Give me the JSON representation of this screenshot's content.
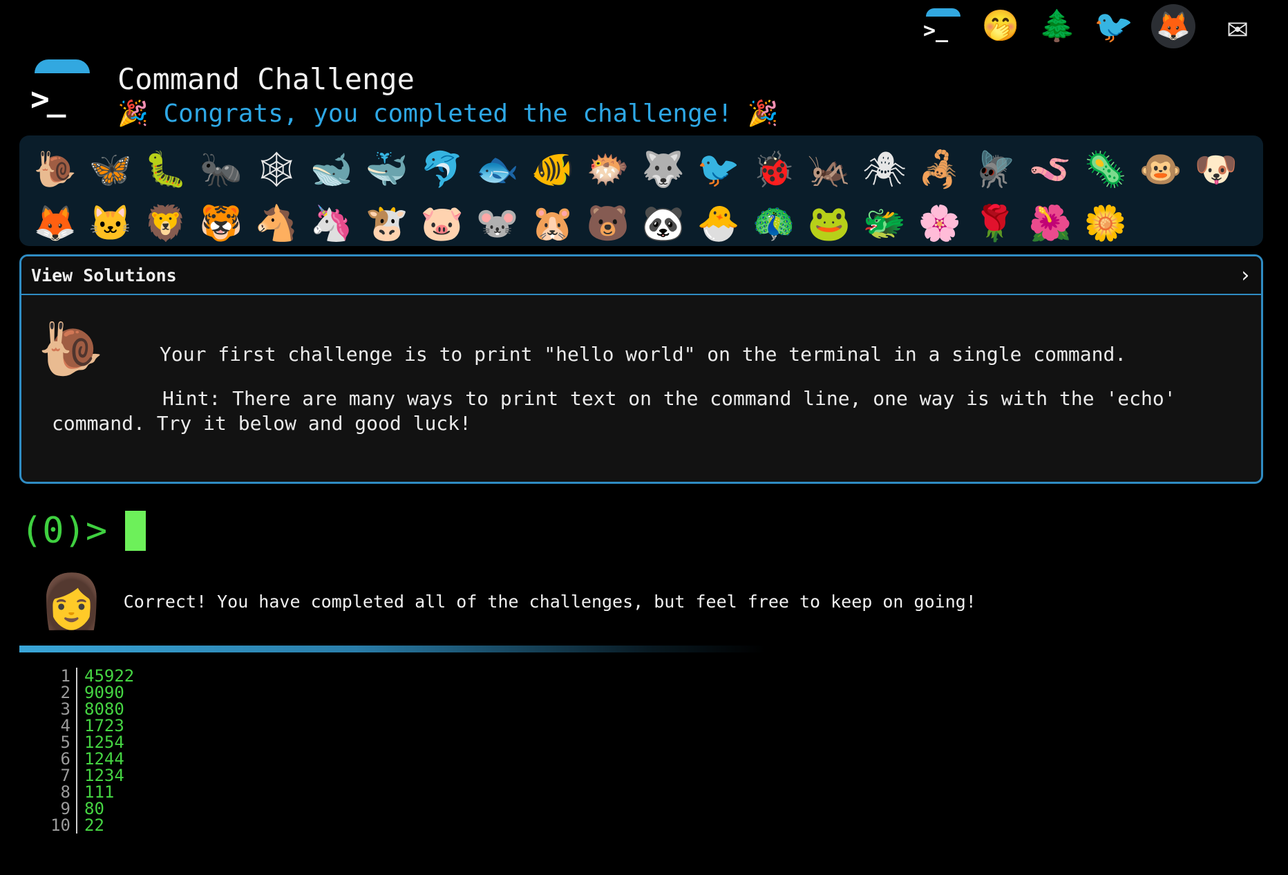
{
  "top_icons": [
    {
      "name": "cmdchallenge-home-icon",
      "glyph": "",
      "kind": "cc"
    },
    {
      "name": "face-with-hand-over-mouth-icon",
      "glyph": "🤭",
      "kind": "emoji"
    },
    {
      "name": "evergreen-tree-icon",
      "glyph": "🌲",
      "kind": "emoji"
    },
    {
      "name": "twitter-bird-icon",
      "glyph": "🐦",
      "kind": "tw"
    },
    {
      "name": "gitlab-fox-icon",
      "glyph": "🦊",
      "kind": "gitlab"
    },
    {
      "name": "envelope-icon",
      "glyph": "✉",
      "kind": "mail"
    }
  ],
  "header": {
    "logo_prompt": ">_",
    "title": "Command Challenge",
    "subtitle": "🎉 Congrats, you completed the challenge! 🎉"
  },
  "levels": [
    {
      "name": "snail",
      "glyph": "🐌"
    },
    {
      "name": "butterfly",
      "glyph": "🦋"
    },
    {
      "name": "caterpillar",
      "glyph": "🐛"
    },
    {
      "name": "ant",
      "glyph": "🐜"
    },
    {
      "name": "spider-web",
      "glyph": "🕸"
    },
    {
      "name": "whale",
      "glyph": "🐋"
    },
    {
      "name": "spouting-whale",
      "glyph": "🐳"
    },
    {
      "name": "dolphin",
      "glyph": "🐬"
    },
    {
      "name": "fish",
      "glyph": "🐟"
    },
    {
      "name": "tropical-fish",
      "glyph": "🐠"
    },
    {
      "name": "blowfish",
      "glyph": "🐡"
    },
    {
      "name": "wolf",
      "glyph": "🐺"
    },
    {
      "name": "bird",
      "glyph": "🐦"
    },
    {
      "name": "lady-beetle",
      "glyph": "🐞"
    },
    {
      "name": "cricket",
      "glyph": "🦗"
    },
    {
      "name": "spider",
      "glyph": "🕷"
    },
    {
      "name": "scorpion",
      "glyph": "🦂"
    },
    {
      "name": "fly",
      "glyph": "🪰"
    },
    {
      "name": "worm",
      "glyph": "🪱"
    },
    {
      "name": "microbe",
      "glyph": "🦠"
    },
    {
      "name": "monkey-face",
      "glyph": "🐵"
    },
    {
      "name": "dog-face",
      "glyph": "🐶"
    },
    {
      "name": "fox",
      "glyph": "🦊"
    },
    {
      "name": "cat-face",
      "glyph": "🐱"
    },
    {
      "name": "lion",
      "glyph": "🦁"
    },
    {
      "name": "tiger-face",
      "glyph": "🐯"
    },
    {
      "name": "horse-face",
      "glyph": "🐴"
    },
    {
      "name": "unicorn",
      "glyph": "🦄"
    },
    {
      "name": "cow-face",
      "glyph": "🐮"
    },
    {
      "name": "pig-face",
      "glyph": "🐷"
    },
    {
      "name": "mouse-face",
      "glyph": "🐭"
    },
    {
      "name": "hamster",
      "glyph": "🐹"
    },
    {
      "name": "bear",
      "glyph": "🐻"
    },
    {
      "name": "panda",
      "glyph": "🐼"
    },
    {
      "name": "hatching-chick",
      "glyph": "🐣"
    },
    {
      "name": "peacock",
      "glyph": "🦚"
    },
    {
      "name": "frog",
      "glyph": "🐸"
    },
    {
      "name": "dragon-face",
      "glyph": "🐲"
    },
    {
      "name": "cherry-blossom",
      "glyph": "🌸"
    },
    {
      "name": "rose",
      "glyph": "🌹"
    },
    {
      "name": "hibiscus",
      "glyph": "🌺"
    },
    {
      "name": "sunflower",
      "glyph": "🌼"
    }
  ],
  "solutions_panel": {
    "header_label": "View Solutions",
    "chevron": "›",
    "challenge_icon": "🐌",
    "challenge_text": "Your first challenge is to print \"hello world\" on the terminal in a single command.",
    "hint_text": "Hint: There are many ways to print text on the command line, one way is with the 'echo' command. Try it below and good luck!"
  },
  "terminal": {
    "prompt": "(0)>",
    "input_value": ""
  },
  "message": {
    "avatar": "👩",
    "text": "Correct! You have completed all of the challenges, but feel free to keep on going!"
  },
  "output": {
    "rows": [
      {
        "num": "1",
        "value": "45922"
      },
      {
        "num": "2",
        "value": "9090"
      },
      {
        "num": "3",
        "value": "8080"
      },
      {
        "num": "4",
        "value": "1723"
      },
      {
        "num": "5",
        "value": "1254"
      },
      {
        "num": "6",
        "value": "1244"
      },
      {
        "num": "7",
        "value": "1234"
      },
      {
        "num": "8",
        "value": "111"
      },
      {
        "num": "9",
        "value": "80"
      },
      {
        "num": "10",
        "value": "22"
      }
    ]
  },
  "colors": {
    "accent": "#2ea8e6",
    "prompt_green": "#3fd040",
    "panel_border": "#2f8cc3",
    "background": "#000000"
  }
}
